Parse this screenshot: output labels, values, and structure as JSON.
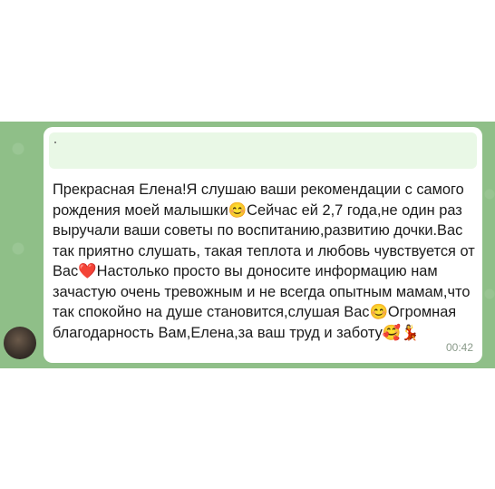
{
  "message": {
    "text": "Прекрасная Елена!Я слушаю ваши рекомендации с самого рождения моей малышки😊Сейчас ей 2,7 года,не один раз выручали ваши советы по воспитанию,развитию дочки.Вас так приятно слушать, такая теплота и любовь чувствуется от Вас❤️Настолько просто вы доносите информацию нам зачастую очень тревожным и не всегда опытным мамам,что так спокойно на душе становится,слушая Вас😊Огромная благодарность Вам,Елена,за ваш труд и заботу🥰💃",
    "time": "00:42"
  },
  "colors": {
    "chat_background": "#8fbf88",
    "bubble": "#ffffff",
    "reply_preview": "#e9f8e6"
  }
}
